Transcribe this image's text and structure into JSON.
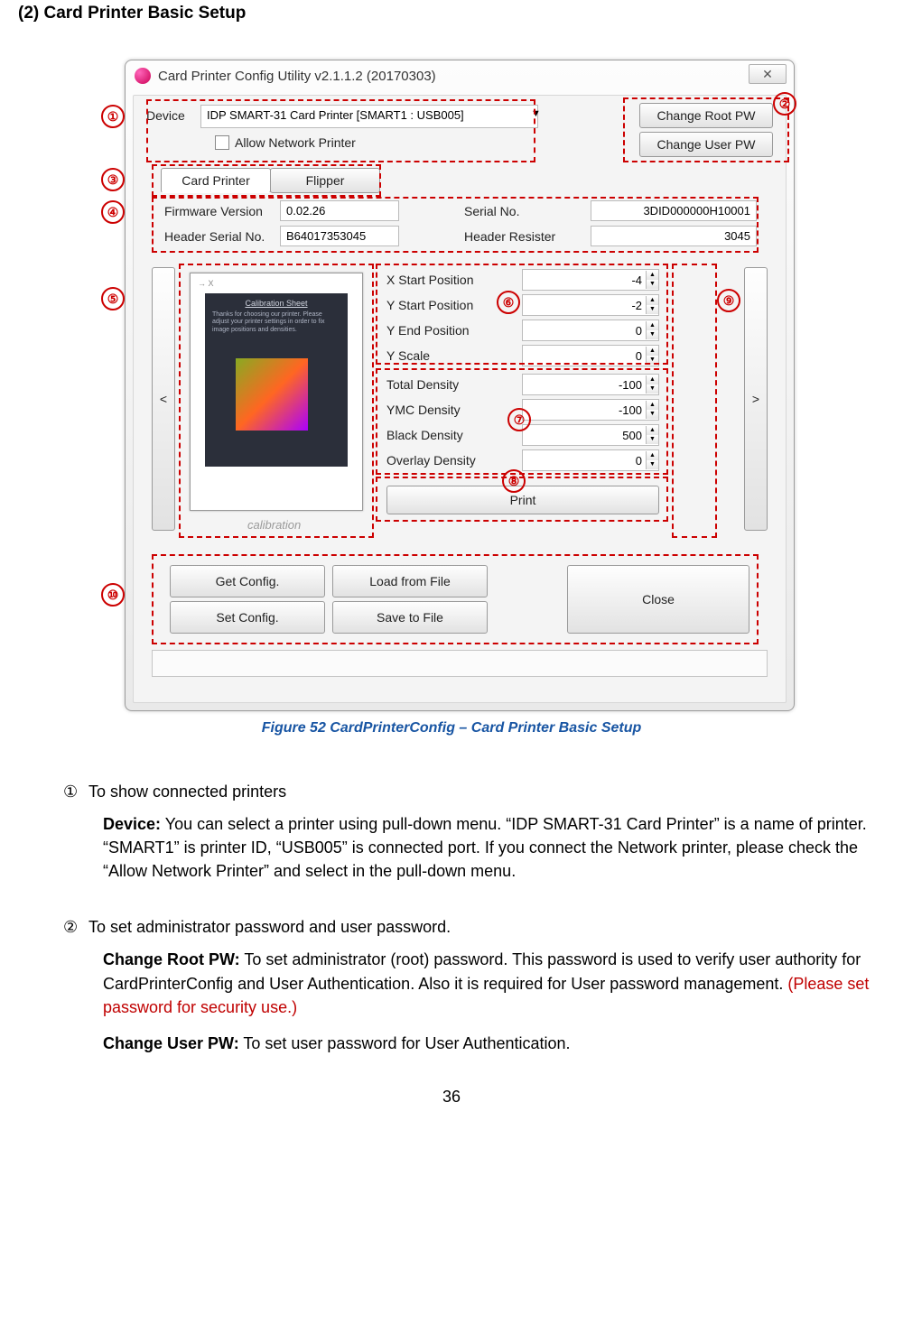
{
  "section_title": "(2) Card Printer Basic Setup",
  "window": {
    "title": "Card Printer Config Utility v2.1.1.2 (20170303)",
    "close_glyph": "✕",
    "device_label": "Device",
    "device_value": "IDP SMART-31 Card Printer  [SMART1 : USB005]",
    "allow_net_label": "Allow Network Printer",
    "btn_change_root": "Change Root PW",
    "btn_change_user": "Change User PW",
    "tab_card": "Card Printer",
    "tab_flipper": "Flipper",
    "fw_label": "Firmware Version",
    "fw_value": "0.02.26",
    "serial_label": "Serial No.",
    "serial_value": "3DID000000H10001",
    "hserial_label": "Header Serial No.",
    "hserial_value": "B64017353045",
    "hres_label": "Header Resister",
    "hres_value": "3045",
    "xstart_label": "X Start Position",
    "xstart_value": "-4",
    "ystart_label": "Y Start Position",
    "ystart_value": "-2",
    "yend_label": "Y End Position",
    "yend_value": "0",
    "yscale_label": "Y Scale",
    "yscale_value": "0",
    "total_label": "Total Density",
    "total_value": "-100",
    "ymc_label": "YMC Density",
    "ymc_value": "-100",
    "black_label": "Black Density",
    "black_value": "500",
    "overlay_label": "Overlay Density",
    "overlay_value": "0",
    "btn_print": "Print",
    "calib_label": "calibration",
    "calib_title": "Calibration Sheet",
    "btn_getcfg": "Get Config.",
    "btn_setcfg": "Set Config.",
    "btn_load": "Load from File",
    "btn_save": "Save to File",
    "btn_close": "Close",
    "nav_left": "<",
    "nav_right": ">"
  },
  "markers": {
    "m1": "①",
    "m2": "②",
    "m3": "③",
    "m4": "④",
    "m5": "⑤",
    "m6": "⑥",
    "m7": "⑦",
    "m8": "⑧",
    "m9": "⑨",
    "m10": "⑩"
  },
  "caption_prefix": "Figure 52 ",
  "caption_rest": "CardPrinterConfig – Card Printer Basic Setup",
  "item1_num": "①",
  "item1_title": "To show connected printers",
  "item1_bold": "Device:",
  "item1_text": " You can select a printer using pull-down menu. “IDP SMART-31 Card Printer” is a name of printer. “SMART1” is printer ID, “USB005” is connected port. If you connect the Network printer, please check the “Allow Network Printer” and select in the pull-down menu.",
  "item2_num": "②",
  "item2_title": "To set administrator password and user password.",
  "item2a_bold": "Change Root PW:",
  "item2a_text": " To set administrator (root) password. This password is used to verify user authority for CardPrinterConfig and User Authentication. Also it is required for User password management. ",
  "item2a_red": "(Please set password for security use.)",
  "item2b_bold": "Change User PW:",
  "item2b_text": " To set user password for User Authentication.",
  "page_number": "36"
}
